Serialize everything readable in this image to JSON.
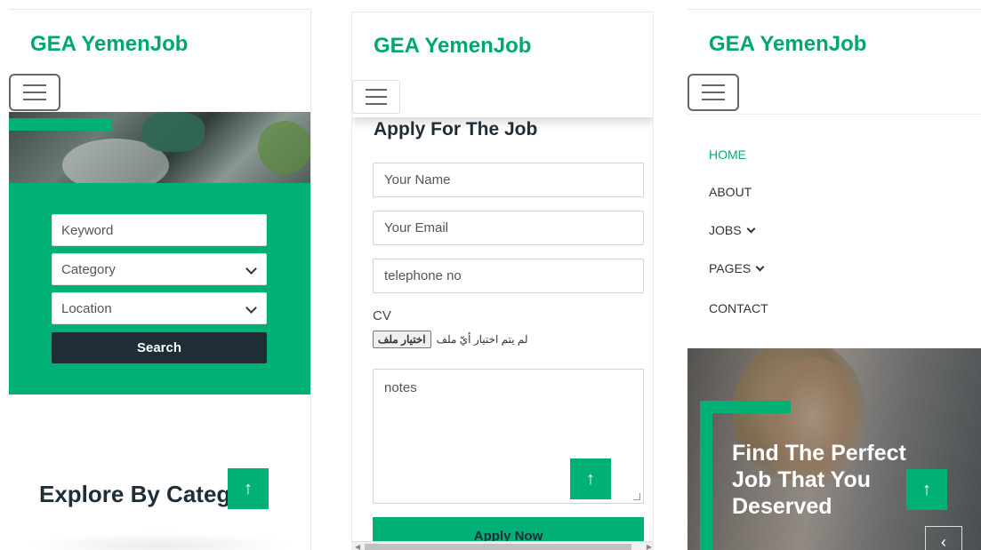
{
  "screen1": {
    "brand": "GEA YemenJob",
    "search_form": {
      "keyword_placeholder": "Keyword",
      "category_value": "Category",
      "location_value": "Location",
      "search_label": "Search"
    },
    "explore_heading": "Explore By Category",
    "scroll_top_glyph": "↑"
  },
  "screen2": {
    "brand": "GEA YemenJob",
    "heading": "Apply For The Job",
    "name_placeholder": "Your Name",
    "email_placeholder": "Your Email",
    "phone_placeholder": "telephone no",
    "cv_label": "CV",
    "file_button": "اختيار ملف",
    "file_status": "لم يتم اختيار أيّ ملف",
    "notes_placeholder": "notes",
    "apply_label": "Apply Now",
    "scroll_top_glyph": "↑"
  },
  "screen3": {
    "brand": "GEA YemenJob",
    "nav": {
      "home": "HOME",
      "about": "ABOUT",
      "jobs": "JOBS",
      "pages": "PAGES",
      "contact": "CONTACT"
    },
    "hero_text": "Find The Perfect Job That You Deserved",
    "scroll_top_glyph": "↑",
    "prev_glyph": "‹"
  },
  "colors": {
    "accent": "#00b074",
    "brand": "#00a86b",
    "dark": "#1f2e36"
  }
}
